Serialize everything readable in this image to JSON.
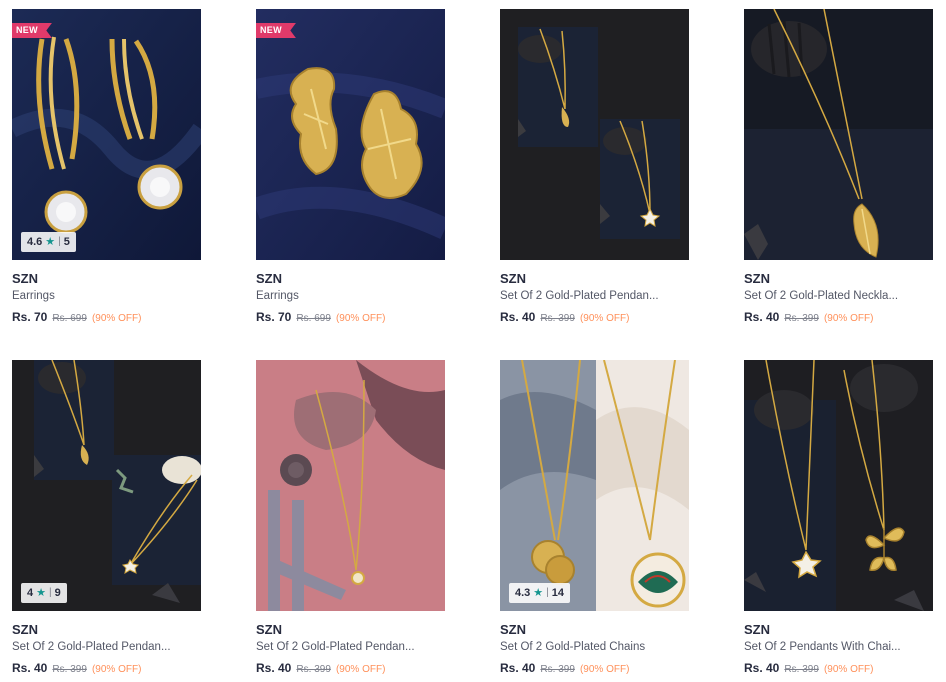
{
  "products": [
    {
      "brand": "SZN",
      "name": "Earrings",
      "price": "Rs. 70",
      "mrp": "Rs. 699",
      "discount": "(90% OFF)",
      "tag": "NEW",
      "rating": {
        "score": "4.6",
        "count": "5"
      }
    },
    {
      "brand": "SZN",
      "name": "Earrings",
      "price": "Rs. 70",
      "mrp": "Rs. 699",
      "discount": "(90% OFF)",
      "tag": "NEW",
      "rating": null
    },
    {
      "brand": "SZN",
      "name": "Set Of 2 Gold-Plated Pendan...",
      "price": "Rs. 40",
      "mrp": "Rs. 399",
      "discount": "(90% OFF)",
      "tag": null,
      "rating": null
    },
    {
      "brand": "SZN",
      "name": "Set Of 2 Gold-Plated Neckla...",
      "price": "Rs. 40",
      "mrp": "Rs. 399",
      "discount": "(90% OFF)",
      "tag": null,
      "rating": null
    },
    {
      "brand": "SZN",
      "name": "Set Of 2 Gold-Plated Pendan...",
      "price": "Rs. 40",
      "mrp": "Rs. 399",
      "discount": "(90% OFF)",
      "tag": null,
      "rating": {
        "score": "4",
        "count": "9"
      }
    },
    {
      "brand": "SZN",
      "name": "Set Of 2 Gold-Plated Pendan...",
      "price": "Rs. 40",
      "mrp": "Rs. 399",
      "discount": "(90% OFF)",
      "tag": null,
      "rating": null
    },
    {
      "brand": "SZN",
      "name": "Set Of 2 Gold-Plated Chains",
      "price": "Rs. 40",
      "mrp": "Rs. 399",
      "discount": "(90% OFF)",
      "tag": null,
      "rating": {
        "score": "4.3",
        "count": "14"
      }
    },
    {
      "brand": "SZN",
      "name": "Set Of 2 Pendants With Chai...",
      "price": "Rs. 40",
      "mrp": "Rs. 399",
      "discount": "(90% OFF)",
      "tag": null,
      "rating": null
    }
  ],
  "icons": {
    "rating_star": "star-icon"
  },
  "colors": {
    "tag_bg": "#e03a6a",
    "discount": "#ff905a",
    "star": "#14958f",
    "gold": "#d4a942"
  }
}
